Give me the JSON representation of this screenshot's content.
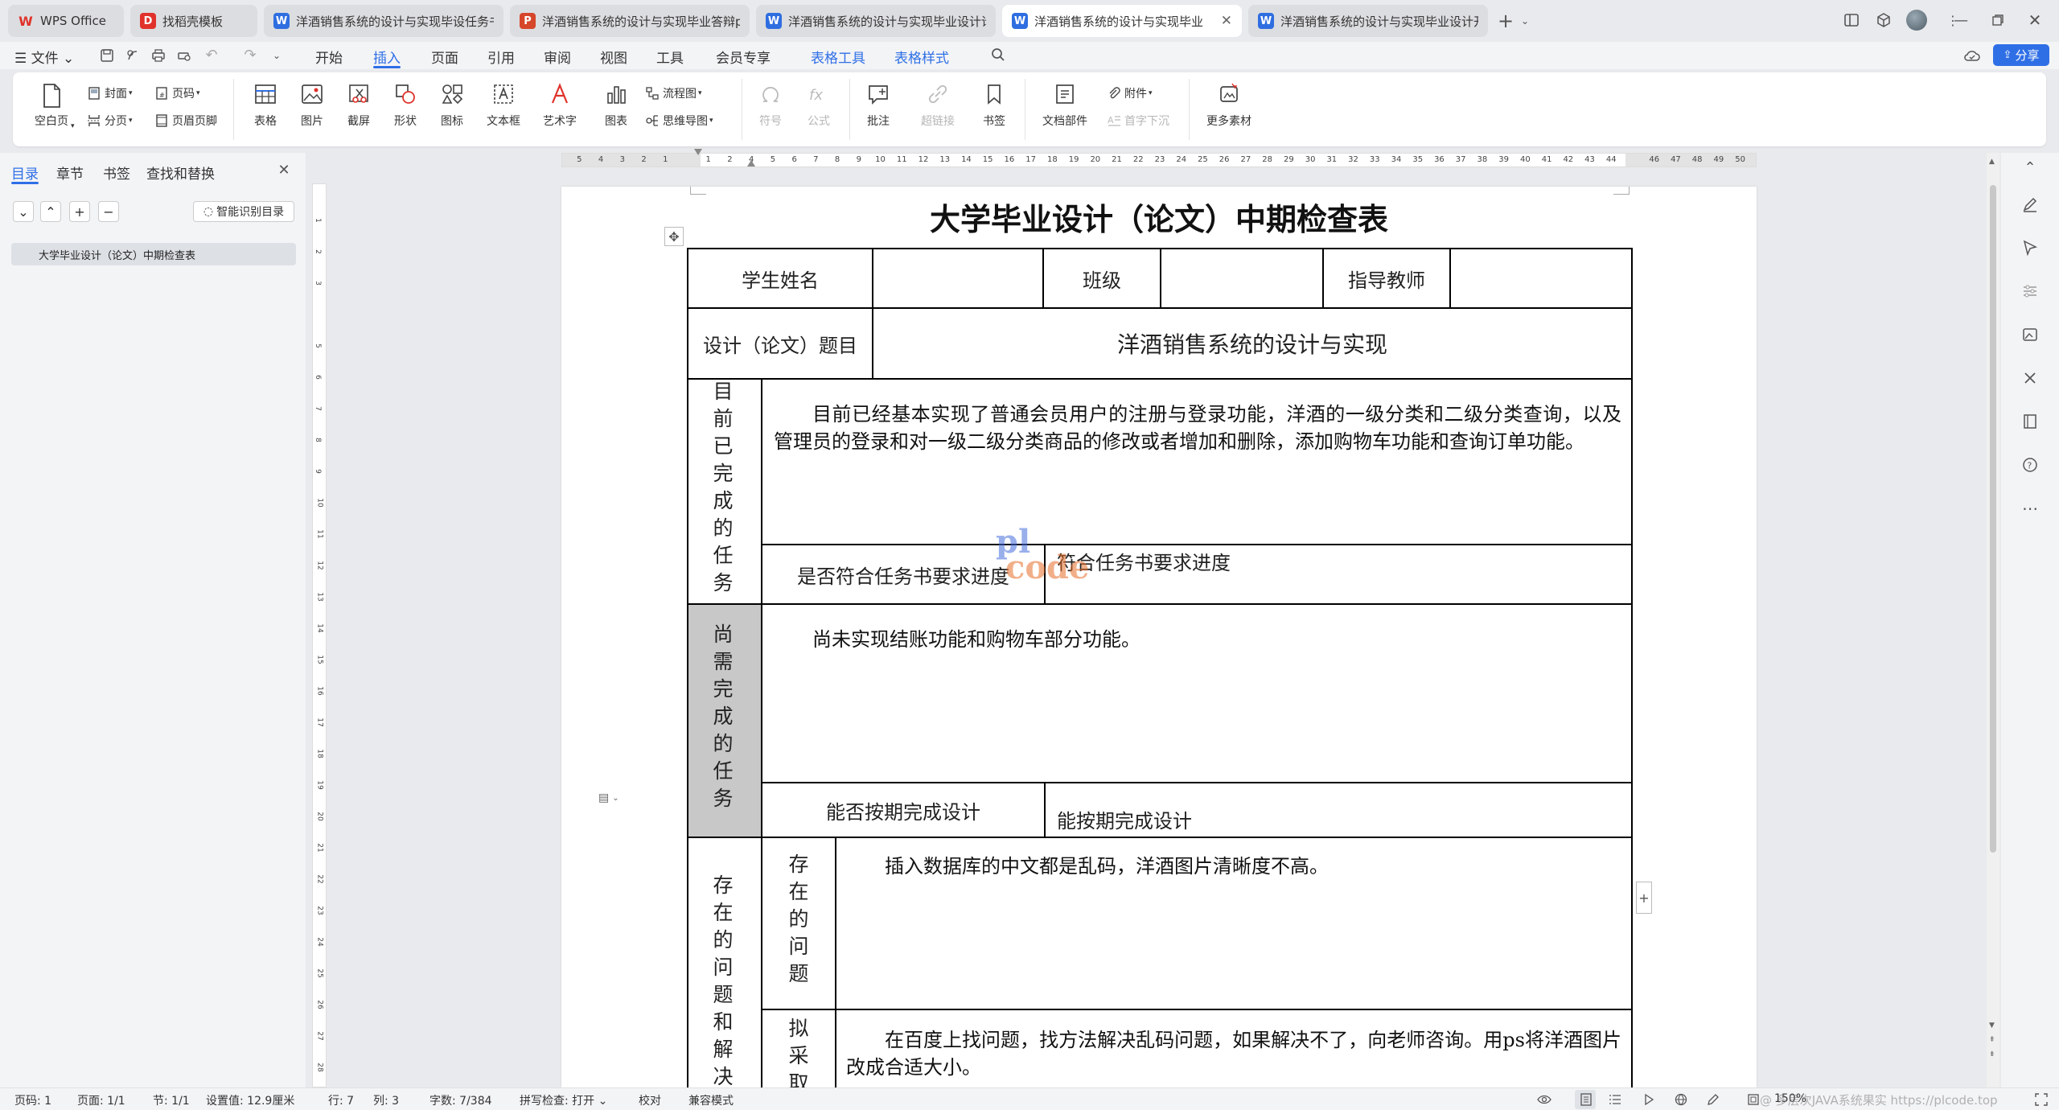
{
  "tabs": [
    {
      "label": "WPS Office",
      "icon": "wps-logo-icon",
      "active": false
    },
    {
      "label": "找稻壳模板",
      "icon": "docer-icon",
      "active": false
    },
    {
      "label": "洋酒销售系统的设计与实现毕设任务书",
      "icon": "word-doc-icon",
      "active": false
    },
    {
      "label": "洋酒销售系统的设计与实现毕业答辩ppt",
      "icon": "ppt-doc-icon",
      "active": false
    },
    {
      "label": "洋酒销售系统的设计与实现毕业设计论文",
      "icon": "word-doc-icon",
      "active": false
    },
    {
      "label": "洋酒销售系统的设计与实现毕业设计中期检查表",
      "icon": "word-doc-icon",
      "active": true
    },
    {
      "label": "洋酒销售系统的设计与实现毕业设计开题报告",
      "icon": "word-doc-icon",
      "active": false
    }
  ],
  "menubar": {
    "file": "文件",
    "items": [
      "开始",
      "插入",
      "页面",
      "引用",
      "审阅",
      "视图",
      "工具",
      "会员专享"
    ],
    "selected": "插入",
    "context_items": [
      "表格工具",
      "表格样式"
    ],
    "share": "分享"
  },
  "ribbon": {
    "blank_page": "空白页",
    "cover": "封面",
    "page_number": "页码",
    "page_break": "分页",
    "header_footer": "页眉页脚",
    "table": "表格",
    "picture": "图片",
    "screenshot": "截屏",
    "shape": "形状",
    "icon": "图标",
    "textbox": "文本框",
    "wordart": "艺术字",
    "chart": "图表",
    "flowchart": "流程图",
    "mindmap": "思维导图",
    "symbol": "符号",
    "formula": "公式",
    "comment": "批注",
    "hyperlink": "超链接",
    "bookmark": "书签",
    "doc_parts": "文档部件",
    "attachment": "附件",
    "dropcap": "首字下沉",
    "more": "更多素材"
  },
  "nav": {
    "tabs": [
      "目录",
      "章节",
      "书签",
      "查找和替换"
    ],
    "selected": "目录",
    "smart_toc": "智能识别目录",
    "toc_items": [
      "大学毕业设计（论文）中期检查表"
    ]
  },
  "ruler": {
    "h_ticks": [
      "5",
      "4",
      "3",
      "2",
      "1",
      "",
      "1",
      "2",
      "4",
      "5",
      "6",
      "7",
      "8",
      "9",
      "10",
      "11",
      "12",
      "13",
      "14",
      "15",
      "16",
      "17",
      "18",
      "19",
      "20",
      "21",
      "22",
      "23",
      "24",
      "25",
      "26",
      "27",
      "28",
      "29",
      "30",
      "31",
      "32",
      "33",
      "34",
      "35",
      "36",
      "37",
      "38",
      "39",
      "40",
      "41",
      "42",
      "43",
      "44",
      "",
      "46",
      "47",
      "48",
      "49",
      "50"
    ],
    "v_ticks": [
      "1",
      "2",
      "3",
      "",
      "5",
      "6",
      "7",
      "8",
      "9",
      "10",
      "11",
      "12",
      "13",
      "14",
      "15",
      "16",
      "17",
      "18",
      "19",
      "20",
      "21",
      "22",
      "23",
      "24",
      "25",
      "26",
      "27",
      "28"
    ]
  },
  "document": {
    "title": "大学毕业设计（论文）中期检查表",
    "student_name_label": "学生姓名",
    "student_name_value": "",
    "class_label": "班级",
    "class_value": "",
    "advisor_label": "指导教师",
    "advisor_value": "",
    "topic_label": "设计（论文）题目",
    "topic_value": "洋酒销售系统的设计与实现",
    "completed_label": "目前已完成的任务",
    "completed_text": "目前已经基本实现了普通会员用户的注册与登录功能，洋酒的一级分类和二级分类查询，以及管理员的登录和对一级二级分类商品的修改或者增加和删除，添加购物车功能和查询订单功能。",
    "progress_label": "是否符合任务书要求进度",
    "progress_value": "符合任务书要求进度",
    "pending_label": "尚需完成的任务",
    "pending_text": "尚未实现结账功能和购物车部分功能。",
    "ontime_label": "能否按期完成设计",
    "ontime_value": "能按期完成设计",
    "issues_label": "存在的问题和解决",
    "problems_label": "存在的问题",
    "problems_text": "插入数据库的中文都是乱码，洋酒图片清晰度不高。",
    "measures_label": "拟采取",
    "measures_text": "在百度上找问题，找方法解决乱码问题，如果解决不了，向老师咨询。用ps将洋酒图片改成合适大小。",
    "watermark": [
      "pl",
      "code"
    ]
  },
  "statusbar": {
    "page": "页码: 1",
    "pages": "页面: 1/1",
    "section": "节: 1/1",
    "setting": "设置值: 12.9厘米",
    "row": "行: 7",
    "col": "列: 3",
    "words": "字数: 7/384",
    "spell": "拼写检查: 打开",
    "proof": "校对",
    "compat": "兼容模式",
    "zoom": "150%",
    "overlay": "@ 多层次JAVA系统果实 https://plcode.top"
  },
  "colors": {
    "accent": "#2f6fe6",
    "wps_red": "#e0322b",
    "word_blue": "#2f6ee0",
    "ppt_orange": "#d6462a",
    "shaded_cell": "#c8c8c8"
  }
}
